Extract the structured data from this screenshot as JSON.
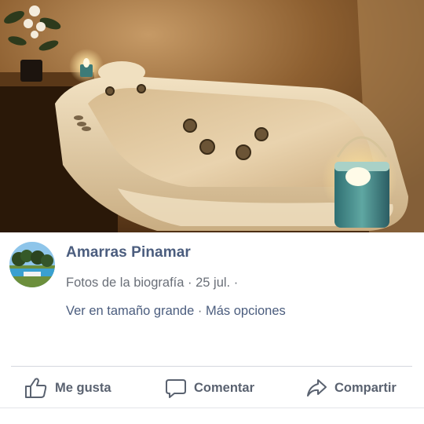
{
  "post": {
    "page_name": "Amarras Pinamar",
    "album": "Fotos de la biografía",
    "date": "25 jul.",
    "view_full_size": "Ver en tamaño grande",
    "more_options": "Más opciones",
    "meta_separator": " · "
  },
  "actions": {
    "like_label": "Me gusta",
    "comment_label": "Comentar",
    "share_label": "Compartir"
  },
  "icons": {
    "like": "thumbs-up-icon",
    "comment": "speech-bubble-icon",
    "share": "share-arrow-icon"
  },
  "colors": {
    "link": "#4b5d7e",
    "meta": "#6a6f78",
    "action": "#5a6270",
    "divider": "#d5d8de"
  }
}
